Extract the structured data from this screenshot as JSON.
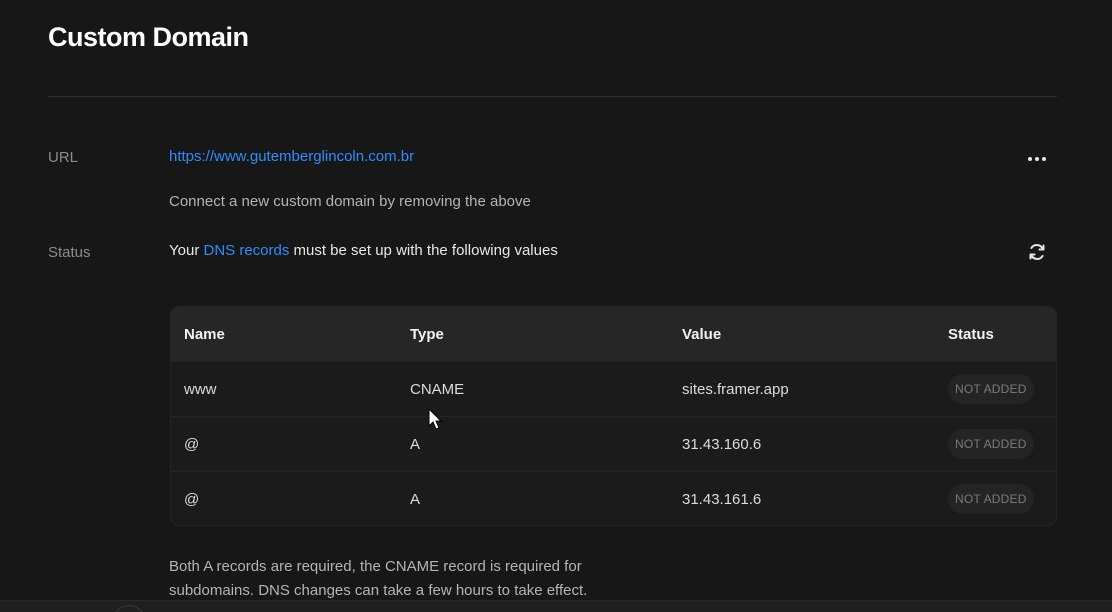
{
  "header": {
    "title": "Custom Domain"
  },
  "url_row": {
    "label": "URL",
    "url": "https://www.gutemberglincoln.com.br",
    "hint": "Connect a new custom domain by removing the above",
    "more_icon": "more-horizontal-icon"
  },
  "status_row": {
    "label": "Status",
    "text_before": "Your ",
    "link": "DNS records",
    "text_after": " must be set up with the following values",
    "refresh_icon": "refresh-icon"
  },
  "dns_table": {
    "headers": [
      "Name",
      "Type",
      "Value",
      "Status"
    ],
    "rows": [
      {
        "name": "www",
        "type": "CNAME",
        "value": "sites.framer.app",
        "status": "NOT ADDED"
      },
      {
        "name": "@",
        "type": "A",
        "value": "31.43.160.6",
        "status": "NOT ADDED"
      },
      {
        "name": "@",
        "type": "A",
        "value": "31.43.161.6",
        "status": "NOT ADDED"
      }
    ]
  },
  "footnote": "Both A records are required, the CNAME record is required for subdomains. DNS changes can take a few hours to take effect.",
  "colors": {
    "background": "#171717",
    "link": "#2e8cff",
    "table_header": "#262626",
    "badge_bg": "#242424"
  }
}
